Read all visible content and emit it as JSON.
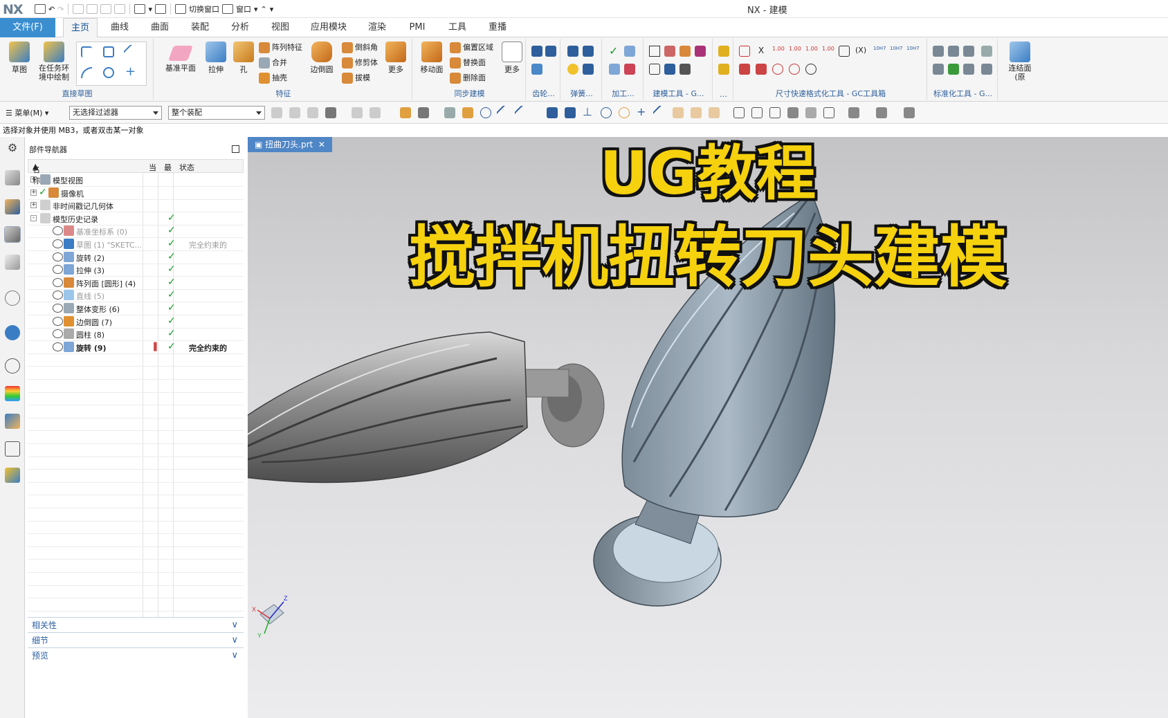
{
  "titlebar": {
    "logo": "NX",
    "switch_window": "切换窗口",
    "window_menu": "窗口",
    "app_title": "NX - 建模"
  },
  "tabs": [
    {
      "label": "文件(F)"
    },
    {
      "label": "主页"
    },
    {
      "label": "曲线"
    },
    {
      "label": "曲面"
    },
    {
      "label": "装配"
    },
    {
      "label": "分析"
    },
    {
      "label": "视图"
    },
    {
      "label": "应用模块"
    },
    {
      "label": "渲染"
    },
    {
      "label": "PMI"
    },
    {
      "label": "工具"
    },
    {
      "label": "重播"
    }
  ],
  "ribbon": {
    "direct_sketch": {
      "caption": "直接草图",
      "sketch": "草图",
      "task_env_line1": "在任务环",
      "task_env_line2": "境中绘制"
    },
    "feature": {
      "caption": "特征",
      "datum_plane": "基准平面",
      "extrude": "拉伸",
      "hole": "孔",
      "pattern": "阵列特征",
      "unite": "合并",
      "shell": "抽壳",
      "edge_blend": "边倒圆",
      "chamfer": "倒斜角",
      "trim_body": "修剪体",
      "draft": "拔模",
      "more": "更多"
    },
    "sync": {
      "caption": "同步建模",
      "move_face": "移动面",
      "offset_region": "偏置区域",
      "replace_face": "替换面",
      "delete_face": "删除面",
      "more": "更多"
    },
    "gear": {
      "caption": "齿轮..."
    },
    "spring": {
      "caption": "弹簧..."
    },
    "machining": {
      "caption": "加工..."
    },
    "modeling_tools": {
      "caption": "建模工具 - G..."
    },
    "dots": {
      "caption": "…"
    },
    "dim_tools": {
      "caption": "尺寸快速格式化工具 - GC工具箱"
    },
    "std_tools": {
      "caption": "标准化工具 - G..."
    },
    "connect": {
      "label_line1": "连结面",
      "label_line2": "(原"
    }
  },
  "selbar": {
    "menu": "菜单(M)",
    "filter": "无选择过滤器",
    "scope": "整个装配"
  },
  "cue": "选择对象并使用 MB3，或者双击某一对象",
  "navigator": {
    "title": "部件导航器",
    "columns": {
      "name": "名称",
      "current": "当",
      "latest": "最",
      "status": "状态"
    },
    "rows": [
      {
        "label": "模型视图",
        "level": 0,
        "exp": "+",
        "status": ""
      },
      {
        "label": "摄像机",
        "level": 0,
        "exp": "+",
        "status": ""
      },
      {
        "label": "非时间戳记几何体",
        "level": 0,
        "exp": "+",
        "status": ""
      },
      {
        "label": "模型历史记录",
        "level": 0,
        "exp": "-",
        "status": ""
      },
      {
        "label": "基准坐标系 (0)",
        "level": 1,
        "status": ""
      },
      {
        "label": "草图 (1) \"SKETC...",
        "level": 1,
        "status": "完全约束的"
      },
      {
        "label": "旋转 (2)",
        "level": 1,
        "status": ""
      },
      {
        "label": "拉伸 (3)",
        "level": 1,
        "status": ""
      },
      {
        "label": "阵列面 [圆形] (4)",
        "level": 1,
        "status": ""
      },
      {
        "label": "直线 (5)",
        "level": 1,
        "status": ""
      },
      {
        "label": "整体变形 (6)",
        "level": 1,
        "status": ""
      },
      {
        "label": "边倒圆 (7)",
        "level": 1,
        "status": ""
      },
      {
        "label": "圆柱 (8)",
        "level": 1,
        "status": ""
      },
      {
        "label": "旋转 (9)",
        "level": 1,
        "status": "完全约束的"
      }
    ],
    "panels": [
      "相关性",
      "细节",
      "预览"
    ]
  },
  "viewport": {
    "tab_label": "扭曲刀头.prt",
    "banner_line1": "UG教程",
    "banner_line2": "搅拌机扭转刀头建模",
    "triad_x": "X",
    "triad_y": "Y",
    "triad_z": "Z"
  }
}
